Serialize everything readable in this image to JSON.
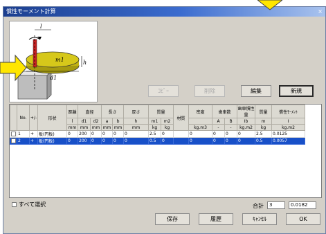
{
  "window": {
    "title": "慣性モーメント計算",
    "close_glyph": "×"
  },
  "actions": {
    "copy": "ｺﾋﾟｰ",
    "delete": "削除",
    "edit": "編集",
    "new": "新規"
  },
  "table": {
    "headers_top": [
      "No.",
      "+/-",
      "形状",
      "距離",
      "直径",
      "長さ",
      "厚さ",
      "質量",
      "材質",
      "密度",
      "歯車数",
      "歯車慣性量",
      "質量",
      "慣性ﾓｰﾒﾝﾄ"
    ],
    "headers_sym": [
      "l",
      "d1",
      "d2",
      "a",
      "b",
      "h",
      "m1",
      "m2",
      "",
      "A",
      "B",
      "Ib",
      "m",
      "I"
    ],
    "headers_unit": [
      "mm",
      "mm",
      "mm",
      "mm",
      "mm",
      "mm",
      "kg",
      "kg",
      "kg.m3",
      "-",
      "-",
      "kg.m2",
      "kg",
      "kg.m2"
    ],
    "rows": [
      {
        "no": "1",
        "sign": "+",
        "shape": "板(円板)",
        "dist": "0",
        "d1": "200",
        "d2": "0",
        "a": "0",
        "b": "0",
        "h": "0",
        "m1": "2.5",
        "m2": "0",
        "material": "",
        "density": "0",
        "gA": "0",
        "gB": "0",
        "ib": "0",
        "m": "2.5",
        "inertia": "0.0125",
        "selected": false
      },
      {
        "no": "2",
        "sign": "+",
        "shape": "板(円板)",
        "dist": "0",
        "d1": "200",
        "d2": "0",
        "a": "0",
        "b": "0",
        "h": "0",
        "m1": "0.5",
        "m2": "0",
        "material": "",
        "density": "0",
        "gA": "0",
        "gB": "0",
        "ib": "0",
        "m": "0.5",
        "inertia": "0.0057",
        "selected": true
      }
    ]
  },
  "footer": {
    "select_all": "すべて選択",
    "total_label": "合計",
    "total_mass": "3",
    "total_inertia": "0.0182",
    "save": "保存",
    "history": "履歴",
    "cancel": "ｷｬﾝｾﾙ",
    "ok": "OK"
  },
  "diagram": {
    "label_l": "l",
    "label_m1": "m1",
    "label_d1": "d1",
    "label_h": "h"
  },
  "colors": {
    "title_bar": "#1c3f8f",
    "selection": "#1850c8",
    "arrow": "#ffe600",
    "disk": "#d6c81a"
  }
}
